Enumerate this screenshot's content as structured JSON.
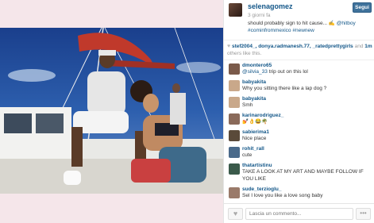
{
  "post": {
    "username": "selenagomez",
    "follow_label": "Segui",
    "posted_ago": "3 giorni fa",
    "caption_text": "should probably sign to hit cause... ✍️ ",
    "caption_mention": "@hitboy",
    "caption_tags": "#cominfrommexico #newnew"
  },
  "likes": {
    "heart": "♥",
    "likers": "stef2004_, donya.radmanesh.77, _ratedprettygirls",
    "and_text": " and ",
    "others_count": "1m",
    "others_suffix": " others like this."
  },
  "comments": [
    {
      "user": "dmontero65",
      "mention": "@silvia_33",
      "text": " trip out on this lol",
      "avatar_color": "#7a5a4a"
    },
    {
      "user": "babyakita",
      "mention": "",
      "text": "Why you sitting there like a lap dog ?",
      "avatar_color": "#c9a88a"
    },
    {
      "user": "babyakita",
      "mention": "",
      "text": "Smh",
      "avatar_color": "#c9a88a"
    },
    {
      "user": "karinarodriguez_",
      "mention": "",
      "text": "💅👌😂🌴",
      "avatar_color": "#8a6a5a"
    },
    {
      "user": "sabierima1",
      "mention": "",
      "text": "Nice place",
      "avatar_color": "#5a4a3a"
    },
    {
      "user": "rohit_rall",
      "mention": "",
      "text": "cute",
      "avatar_color": "#4a6a8a"
    },
    {
      "user": "thatartistinu",
      "mention": "",
      "text": "TAKE A LOOK AT MY ART AND MAYBE FOLLOW IF YOU LIKE",
      "avatar_color": "#3a5a4a"
    },
    {
      "user": "sude_terzioglu_",
      "mention": "",
      "text": "Sel I love you like a love song baby",
      "avatar_color": "#9a7a6a"
    }
  ],
  "footer": {
    "like_icon": "♥",
    "comment_placeholder": "Lascia un commento...",
    "more_icon": "•••"
  },
  "colors": {
    "link": "#125688",
    "follow_bg": "#3f729b",
    "page_bg": "#f6e9ec"
  }
}
